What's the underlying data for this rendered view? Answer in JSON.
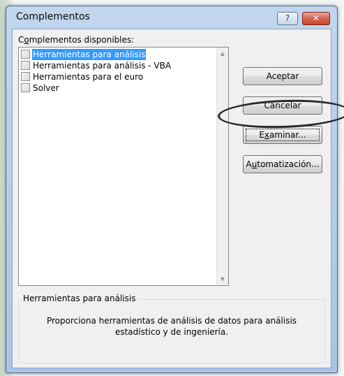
{
  "window": {
    "title": "Complementos",
    "help_glyph": "?",
    "close_glyph": "✕"
  },
  "available_label": {
    "accel": "o",
    "before": "C",
    "after": "mplementos disponibles:"
  },
  "addins": [
    {
      "label": "Herramientas para análisis",
      "checked": false,
      "selected": true
    },
    {
      "label": "Herramientas para análisis - VBA",
      "checked": false,
      "selected": false
    },
    {
      "label": "Herramientas para el euro",
      "checked": false,
      "selected": false
    },
    {
      "label": "Solver",
      "checked": false,
      "selected": false
    }
  ],
  "buttons": {
    "accept": "Aceptar",
    "cancel": "Cancelar",
    "browse_before": "E",
    "browse_accel": "x",
    "browse_after": "aminar...",
    "auto_before": "A",
    "auto_accel": "u",
    "auto_after": "tomatización..."
  },
  "description": {
    "title": "Herramientas para análisis",
    "text_line1": "Proporciona herramientas de análisis de datos para análisis",
    "text_line2": "estadístico y de ingeniería."
  },
  "scrollbar": {
    "up_icon": "▲",
    "down_icon": "▼"
  },
  "colors": {
    "selection": "#3399ff",
    "close_button": "#c8432d",
    "title_bar": "#b5cde8"
  }
}
